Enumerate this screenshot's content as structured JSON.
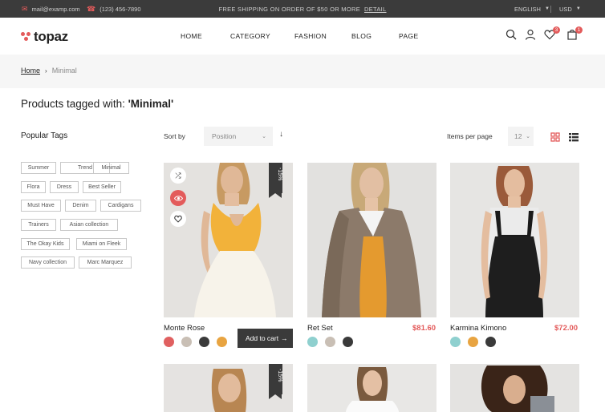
{
  "topbar": {
    "email": "mail@examp.com",
    "phone": "(123) 456-7890",
    "shipping_text": "FREE SHIPPING ON ORDER OF $50 OR MORE",
    "shipping_link": "DETAIL",
    "language": "ENGLISH",
    "currency": "USD"
  },
  "header": {
    "logo": "topaz",
    "nav": [
      "HOME",
      "CATEGORY",
      "FASHION",
      "BLOG",
      "PAGE"
    ],
    "wishlist_count": "3",
    "cart_count": "1"
  },
  "breadcrumb": {
    "home": "Home",
    "current": "Minimal"
  },
  "title": {
    "prefix": "Products tagged with: ",
    "tag": "'Minimal'"
  },
  "sidebar": {
    "title": "Popular Tags",
    "tags": [
      "Summer",
      "Trend",
      "Minimal",
      "Flora",
      "Dress",
      "Best Seller",
      "Must Have",
      "Denim",
      "Cardigans",
      "Trainers",
      "Asian collection",
      "The Okay Kids",
      "Miami on Fleek",
      "Navy collection",
      "Marc Marquez"
    ]
  },
  "toolbar": {
    "sort_label": "Sort by",
    "sort_value": "Position",
    "per_page_label": "Items per page",
    "per_page_value": "12"
  },
  "products": [
    {
      "name": "Monte Rose",
      "price": "",
      "sale": "-15%",
      "add_to_cart": "Add to cart",
      "swatches": [
        "#e06060",
        "#c9bfb5",
        "#3a3a3a",
        "#e8a441"
      ]
    },
    {
      "name": "Ret Set",
      "price": "$81.60",
      "swatches": [
        "#8fd0cf",
        "#c9bfb5",
        "#3a3a3a"
      ]
    },
    {
      "name": "Karmina Kimono",
      "price": "$72.00",
      "swatches": [
        "#8fd0cf",
        "#e8a441",
        "#3a3a3a"
      ]
    }
  ],
  "row2": {
    "sale": "-15%"
  },
  "colors": {
    "accent": "#e35b5b",
    "dark": "#3a3a3a",
    "topbar": "#3b3b3b"
  }
}
